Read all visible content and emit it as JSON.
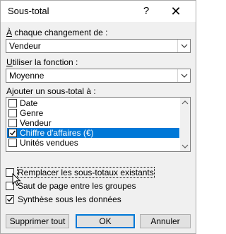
{
  "title": "Sous-total",
  "titlebar": {
    "help_label": "?",
    "close_label": "✕"
  },
  "group_change": {
    "label": "À chaque changement de :",
    "value": "Vendeur"
  },
  "function": {
    "label": "Utiliser la fonction :",
    "value": "Moyenne"
  },
  "add_subtotal": {
    "label": "Ajouter un sous-total à :",
    "items": [
      {
        "label": "Date",
        "checked": false
      },
      {
        "label": "Genre",
        "checked": false
      },
      {
        "label": "Vendeur",
        "checked": false
      },
      {
        "label": "Chiffre d'affaires (€)",
        "checked": true
      },
      {
        "label": "Unités vendues",
        "checked": false
      }
    ]
  },
  "options": {
    "replace": {
      "label": "Remplacer les sous-totaux existants",
      "checked": false
    },
    "page_break": {
      "label": "Saut de page entre les groupes",
      "checked": false
    },
    "summary": {
      "label": "Synthèse sous les données",
      "checked": true
    }
  },
  "buttons": {
    "remove_all": "Supprimer tout",
    "ok": "OK",
    "cancel": "Annuler"
  },
  "colors": {
    "selection": "#0078d7",
    "dialog_bg": "#f0f0f0"
  }
}
